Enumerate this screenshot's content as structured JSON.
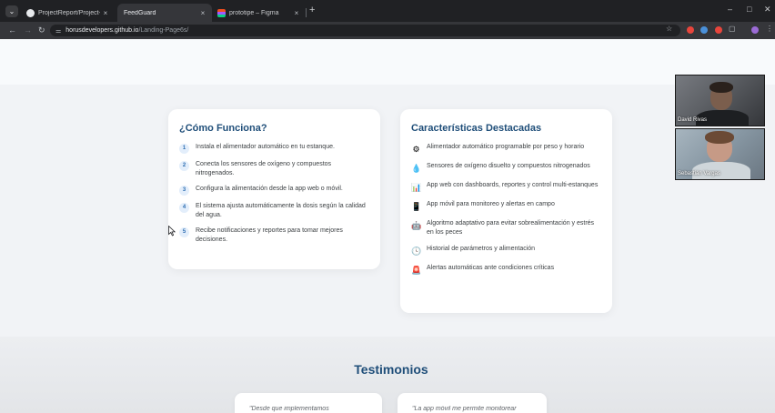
{
  "browser": {
    "tabs": [
      {
        "label": "ProjectReport/Project-Reportin",
        "active": false,
        "icon": "github-icon"
      },
      {
        "label": "FeedGuard",
        "active": true,
        "icon": "page-icon"
      },
      {
        "label": "prototipe – Figma",
        "active": false,
        "icon": "figma-icon"
      }
    ],
    "new_tab": "+",
    "close_glyph": "×",
    "window_controls": {
      "minimize": "–",
      "restore": "□",
      "close": "✕"
    },
    "url_host": "horusdevelopers.github.io",
    "url_path": "/Landing-Page6s/"
  },
  "how_it_works": {
    "title": "¿Cómo Funciona?",
    "steps": [
      {
        "num": "1",
        "text": "Instala el alimentador automático en tu estanque."
      },
      {
        "num": "2",
        "text": "Conecta los sensores de oxígeno y compuestos nitrogenados."
      },
      {
        "num": "3",
        "text": "Configura la alimentación desde la app web o móvil."
      },
      {
        "num": "4",
        "text": "El sistema ajusta automáticamente la dosis según la calidad del agua."
      },
      {
        "num": "5",
        "text": "Recibe notificaciones y reportes para tomar mejores decisiones."
      }
    ]
  },
  "features": {
    "title": "Características Destacadas",
    "items": [
      {
        "icon": "gear-icon",
        "glyph": "⚙",
        "text": "Alimentador automático programable por peso y horario"
      },
      {
        "icon": "water-drop-icon",
        "glyph": "💧",
        "text": "Sensores de oxígeno disuelto y compuestos nitrogenados"
      },
      {
        "icon": "bar-chart-icon",
        "glyph": "📊",
        "text": "App web con dashboards, reportes y control multi-estanques"
      },
      {
        "icon": "mobile-phone-icon",
        "glyph": "📱",
        "text": "App móvil para monitoreo y alertas en campo"
      },
      {
        "icon": "robot-icon",
        "glyph": "🤖",
        "text": "Algoritmo adaptativo para evitar sobrealimentación y estrés en los peces"
      },
      {
        "icon": "clock-icon",
        "glyph": "🕓",
        "text": "Historial de parámetros y alimentación"
      },
      {
        "icon": "siren-icon",
        "glyph": "🚨",
        "text": "Alertas automáticas ante condiciones críticas"
      }
    ]
  },
  "testimonials": {
    "title": "Testimonios",
    "quotes": [
      "\"Desde que implementamos",
      "\"La app móvil me permite monitorear"
    ]
  },
  "video_call": {
    "participants": [
      "David Rivas",
      "Sebastián Vargas"
    ]
  },
  "colors": {
    "accent": "#1f4e79",
    "step_badge_bg": "#e3eefb",
    "page_bg": "#f1f3f6",
    "browser_dark": "#202124"
  }
}
